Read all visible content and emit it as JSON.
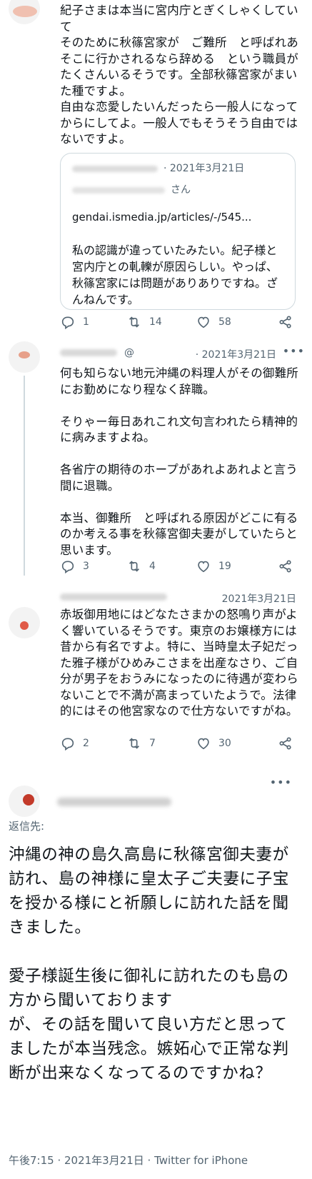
{
  "tweets": [
    {
      "text": "紀子さまは本当に宮内庁とぎくしゃくしていて\nそのために秋篠宮家が　ご難所　と呼ばれあそこに行かされるなら辞める　という職員がたくさんいるそうです。全部秋篠宮家がまいた種ですよ。\n自由な恋愛したいんだったら一般人になってからにしてよ。一般人でもそうそう自由ではないですよ。",
      "quote": {
        "date": "· 2021年3月21日",
        "handle_suffix": "さん",
        "link": "gendai.ismedia.jp/articles/-/545...",
        "text": "私の認識が違っていたみたい。紀子様と宮内庁との軋轢が原因らしい。やっぱ、秋篠宮家には問題がありありですね。ざんねんです。"
      },
      "stats": {
        "replies": "1",
        "retweets": "14",
        "likes": "58"
      }
    },
    {
      "handle": "@",
      "date": "· 2021年3月21日",
      "more": "•••",
      "text": "何も知らない地元沖縄の料理人がその御難所にお勤めになり程なく辞職。\n\nそりゃー毎日あれこれ文句言われたら精神的に病みますよね。\n\n各省庁の期待のホープがあれよあれよと言う間に退職。\n\n本当、御難所　と呼ばれる原因がどこに有るのか考える事を秋篠宮御夫妻がしていたらと思います。",
      "stats": {
        "replies": "3",
        "retweets": "4",
        "likes": "19"
      }
    },
    {
      "date": "2021年3月21日",
      "text": "赤坂御用地にはどなたさまかの怒鳴り声がよく響いているそうです。東京のお嬢様方には昔から有名ですよ。特に、当時皇太子妃だった雅子様がひめみこさまを出産なさり、ご自分が男子をおうみになったのに待遇が変わらないことで不満が高まっていたようで。法律的にはその他宮家なので仕方ないですがね。",
      "stats": {
        "replies": "2",
        "retweets": "7",
        "likes": "30"
      }
    }
  ],
  "focus": {
    "more": "•••",
    "reply_to": "返信先:",
    "text": "沖縄の神の島久高島に秋篠宮御夫妻が訪れ、島の神様に皇太子ご夫妻に子宝を授かる様にと祈願しに訪れた話を聞きました。\n\n愛子様誕生後に御礼に訪れたのも島の方から聞いております\nが、その話を聞いて良い方だと思ってましたが本当残念。嫉妬心で正常な判断が出来なくなってるのですかね？",
    "meta": "午後7:15 · 2021年3月21日 · Twitter for iPhone"
  },
  "colors": {
    "text": "#0f1419",
    "secondary": "#536471",
    "border": "#cfd9de"
  },
  "icons": [
    "reply-icon",
    "retweet-icon",
    "like-icon",
    "share-icon",
    "more-icon"
  ]
}
